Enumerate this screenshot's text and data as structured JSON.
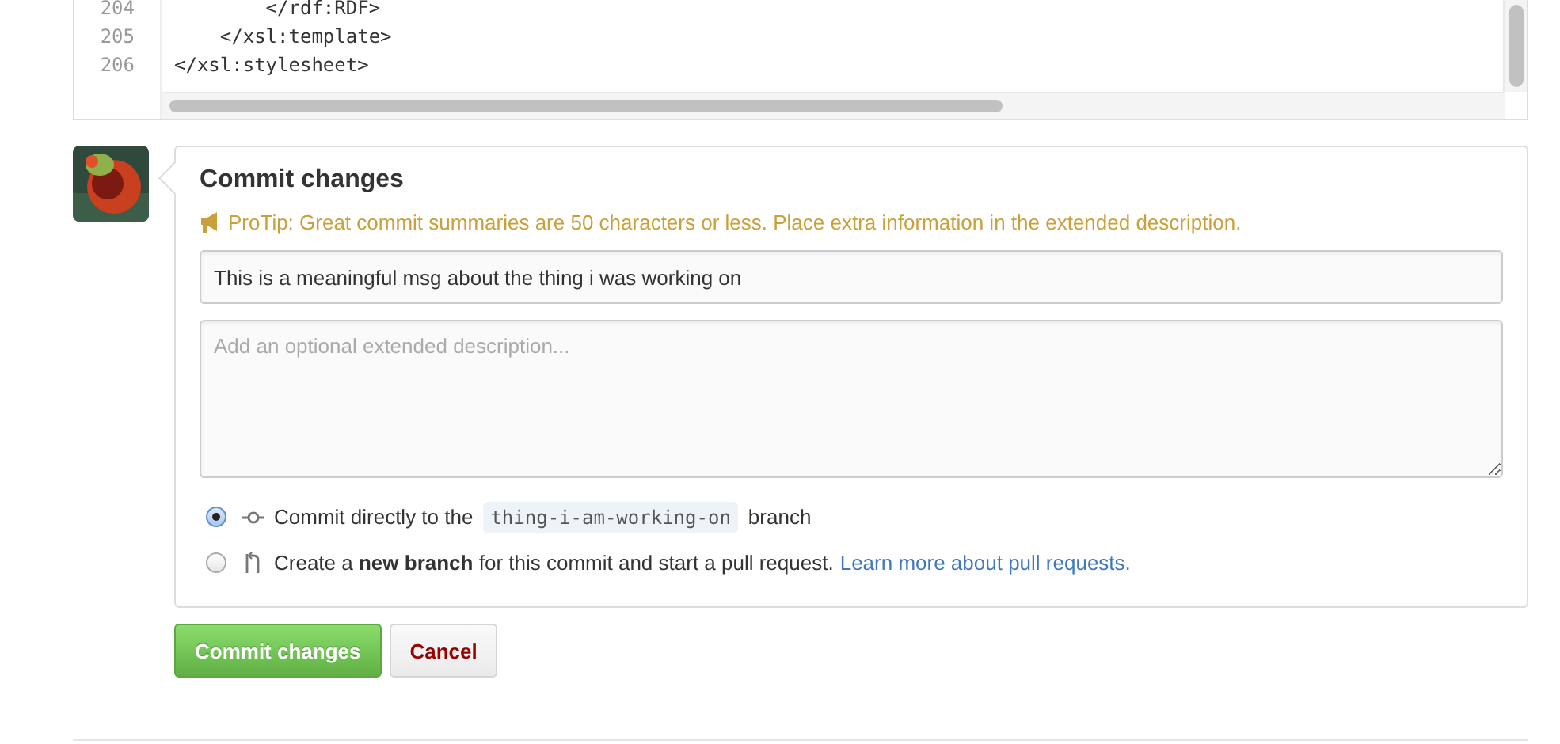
{
  "code_lines": [
    {
      "number": "204",
      "text": "        </rdf:RDF>"
    },
    {
      "number": "205",
      "text": "    </xsl:template>"
    },
    {
      "number": "206",
      "text": "</xsl:stylesheet>"
    }
  ],
  "commit": {
    "title": "Commit changes",
    "protip": "ProTip: Great commit summaries are 50 characters or less. Place extra information in the extended description.",
    "summary": {
      "value": "This is a meaningful msg about the thing i was working on"
    },
    "description": {
      "placeholder": "Add an optional extended description..."
    },
    "options": [
      {
        "kind": "direct",
        "selected": true,
        "text": "Commit directly to the",
        "branch": "thing-i-am-working-on",
        "suffix": "branch"
      },
      {
        "kind": "new-branch",
        "selected": false,
        "text": "Create a **new branch** for this commit and start a pull request.",
        "link": "Learn more about pull requests."
      }
    ],
    "buttons": [
      {
        "kind": "primary",
        "label": "Commit changes"
      },
      {
        "kind": "cancel",
        "label": "Cancel"
      }
    ]
  }
}
